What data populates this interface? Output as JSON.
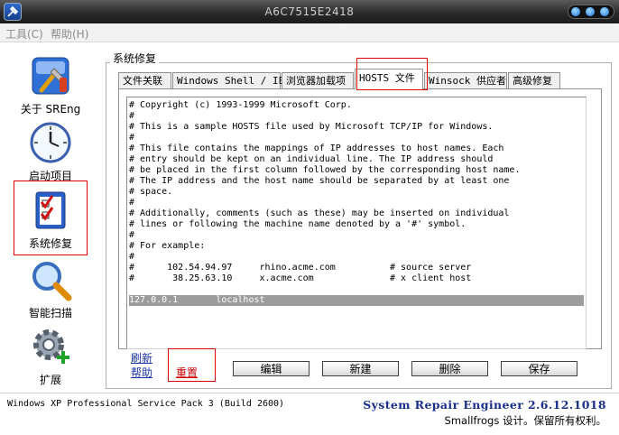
{
  "window": {
    "title": "A6C7515E2418"
  },
  "menu": [
    {
      "label": "工具(C)"
    },
    {
      "label": "帮助(H)"
    }
  ],
  "sidebar": {
    "items": [
      {
        "label": "关于 SREng",
        "icon": "tools-app-icon"
      },
      {
        "label": "启动项目",
        "icon": "clock-icon"
      },
      {
        "label": "系统修复",
        "icon": "checklist-icon",
        "active": true
      },
      {
        "label": "智能扫描",
        "icon": "magnifier-icon"
      },
      {
        "label": "扩展",
        "icon": "gear-plus-icon"
      }
    ]
  },
  "group": {
    "title": "系统修复"
  },
  "tabs": [
    {
      "label": "文件关联"
    },
    {
      "label": "Windows Shell / IE"
    },
    {
      "label": "浏览器加载项"
    },
    {
      "label": "HOSTS 文件",
      "active": true
    },
    {
      "label": "Winsock 供应者"
    },
    {
      "label": "高级修复"
    }
  ],
  "hosts_file": {
    "lines": [
      "# Copyright (c) 1993-1999 Microsoft Corp.",
      "#",
      "# This is a sample HOSTS file used by Microsoft TCP/IP for Windows.",
      "#",
      "# This file contains the mappings of IP addresses to host names. Each",
      "# entry should be kept on an individual line. The IP address should",
      "# be placed in the first column followed by the corresponding host name.",
      "# The IP address and the host name should be separated by at least one",
      "# space.",
      "#",
      "# Additionally, comments (such as these) may be inserted on individual",
      "# lines or following the machine name denoted by a '#' symbol.",
      "#",
      "# For example:",
      "#",
      "#      102.54.94.97     rhino.acme.com          # source server",
      "#       38.25.63.10     x.acme.com              # x client host",
      "",
      "127.0.0.1       localhost"
    ],
    "selected_line": "127.0.0.1       localhost"
  },
  "actions": {
    "refresh": "刷新",
    "help": "帮助",
    "reset": "重置",
    "edit": "编辑",
    "new": "新建",
    "delete": "删除",
    "save": "保存"
  },
  "status": {
    "os": "Windows XP Professional Service Pack 3 (Build 2600)",
    "brand": "System Repair Engineer 2.6.12.1018",
    "copyright": "Smallfrogs 设计。保留所有权利。"
  },
  "colors": {
    "highlight_border": "#e00000",
    "brand": "#1a2e8a",
    "link": "#1a35a8",
    "selection": "#9c9c9c"
  }
}
